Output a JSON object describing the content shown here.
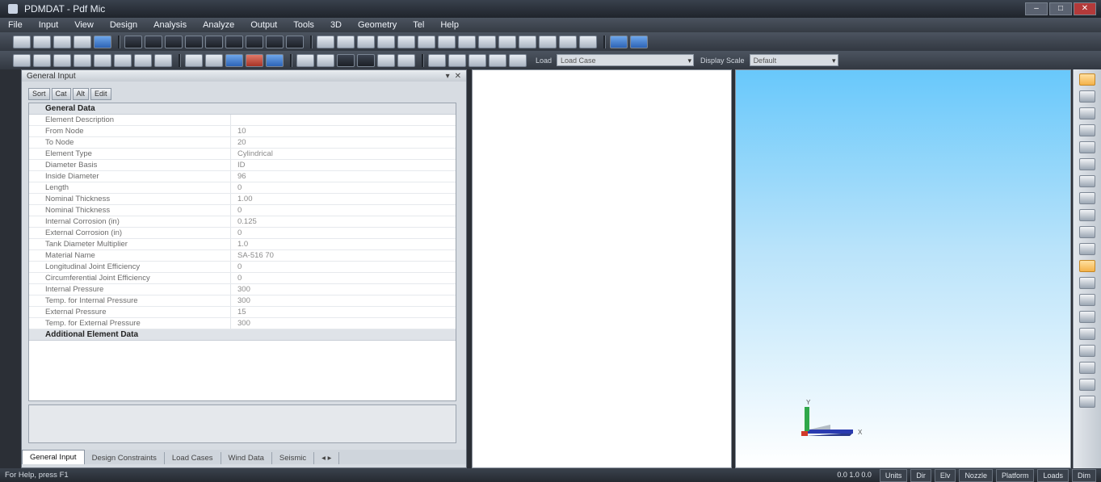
{
  "window": {
    "title": "PDMDAT - Pdf Mic"
  },
  "menu": [
    "File",
    "Input",
    "View",
    "Design",
    "Analysis",
    "Analyze",
    "Output",
    "Tools",
    "3D",
    "Geometry",
    "Tel",
    "Help"
  ],
  "toolbar": {
    "combo_dropdown_arrow": "▾",
    "view_label": "Load",
    "view_value": "Load Case",
    "scale_label": "Display Scale",
    "scale_value": "Default"
  },
  "panel": {
    "title": "General Input",
    "pin": "▾",
    "close": "✕",
    "tools": [
      "Sort",
      "Cat",
      "Alt",
      "Edit"
    ],
    "groups": [
      {
        "name": "General Data",
        "rows": [
          {
            "k": "Element Description",
            "v": ""
          },
          {
            "k": "From Node",
            "v": "10"
          },
          {
            "k": "To Node",
            "v": "20"
          },
          {
            "k": "Element Type",
            "v": "Cylindrical"
          },
          {
            "k": "Diameter Basis",
            "v": "ID"
          },
          {
            "k": "Inside Diameter",
            "v": "96"
          },
          {
            "k": "Length",
            "v": "0"
          },
          {
            "k": "Nominal Thickness",
            "v": "1.00"
          },
          {
            "k": "Nominal Thickness",
            "v": "0"
          },
          {
            "k": "Internal Corrosion (in)",
            "v": "0.125"
          },
          {
            "k": "External Corrosion (in)",
            "v": "0"
          },
          {
            "k": "Tank Diameter Multiplier",
            "v": "1.0"
          },
          {
            "k": "Material Name",
            "v": "SA-516 70"
          },
          {
            "k": "Longitudinal Joint Efficiency",
            "v": "0"
          },
          {
            "k": "Circumferential Joint Efficiency",
            "v": "0"
          },
          {
            "k": "Internal Pressure",
            "v": "300"
          },
          {
            "k": "Temp. for Internal Pressure",
            "v": "300"
          },
          {
            "k": "External Pressure",
            "v": "15"
          },
          {
            "k": "Temp. for External Pressure",
            "v": "300"
          }
        ]
      },
      {
        "name": "Additional Element Data",
        "rows": []
      }
    ],
    "tabs": [
      "General Input",
      "Design Constraints",
      "Load Cases",
      "Wind Data",
      "Seismic"
    ],
    "tab_scroll": "◂ ▸"
  },
  "axes": {
    "x": "X",
    "y": "Y"
  },
  "status": {
    "help": "For Help, press F1",
    "coords": "0.0  1.0  0.0",
    "indicators": [
      "Units",
      "Dir",
      "Elv",
      "Nozzle",
      "Platform",
      "Loads",
      "Dim"
    ]
  }
}
